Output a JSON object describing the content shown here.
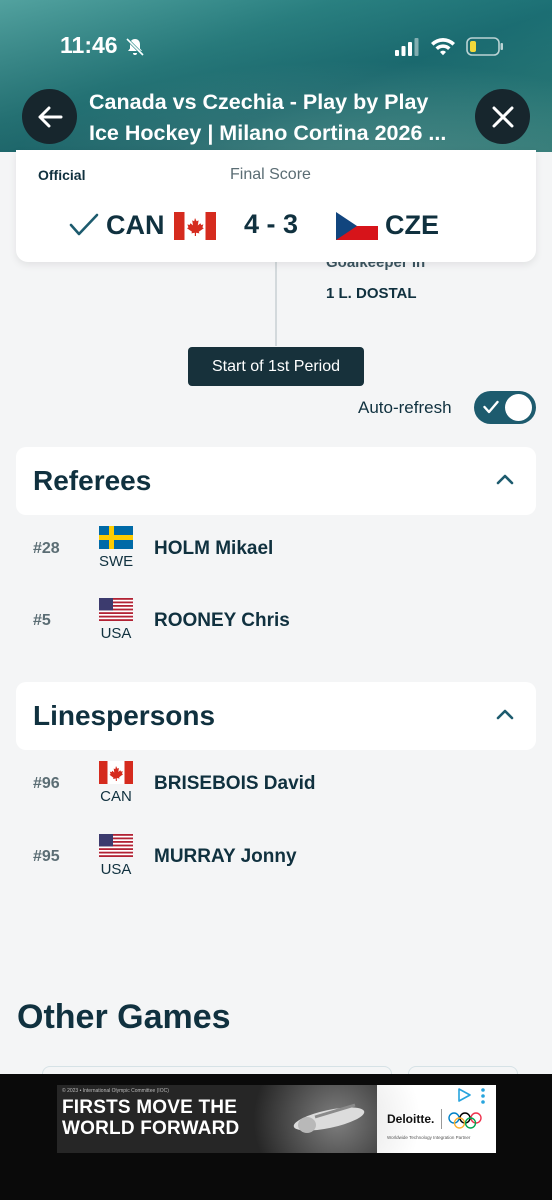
{
  "status_bar": {
    "time": "11:46"
  },
  "header": {
    "title_line1": "Canada vs Czechia - Play by Play",
    "title_line2": "Ice Hockey | Milano Cortina 2026 ..."
  },
  "background_event": {
    "text": "Goalkeeper in",
    "player": "1 L. DOSTAL"
  },
  "score_card": {
    "official": "Official",
    "status": "Final Score",
    "team_a": "CAN",
    "score": "4 - 3",
    "team_b": "CZE"
  },
  "period_marker": "Start of 1st Period",
  "auto_refresh": {
    "label": "Auto-refresh",
    "on": true
  },
  "referees": {
    "title": "Referees",
    "items": [
      {
        "number": "#28",
        "nation": "SWE",
        "name": "HOLM Mikael"
      },
      {
        "number": "#5",
        "nation": "USA",
        "name": "ROONEY Chris"
      }
    ]
  },
  "linespersons": {
    "title": "Linespersons",
    "items": [
      {
        "number": "#96",
        "nation": "CAN",
        "name": "BRISEBOIS David"
      },
      {
        "number": "#95",
        "nation": "USA",
        "name": "MURRAY Jonny"
      }
    ]
  },
  "other_games": {
    "title": "Other Games"
  },
  "ad": {
    "copyright": "© 2023 • International Olympic Committee (IOC)",
    "slogan_line1": "FIRSTS MOVE THE",
    "slogan_line2": "WORLD FORWARD",
    "brand": "Deloitte.",
    "tagline": "Worldwide Technology Integration Partner"
  },
  "colors": {
    "dark_navy": "#10313f",
    "badge_bg": "#17313b",
    "toggle_on": "#1d5b6e",
    "header_teal": "#2f8f8e"
  }
}
